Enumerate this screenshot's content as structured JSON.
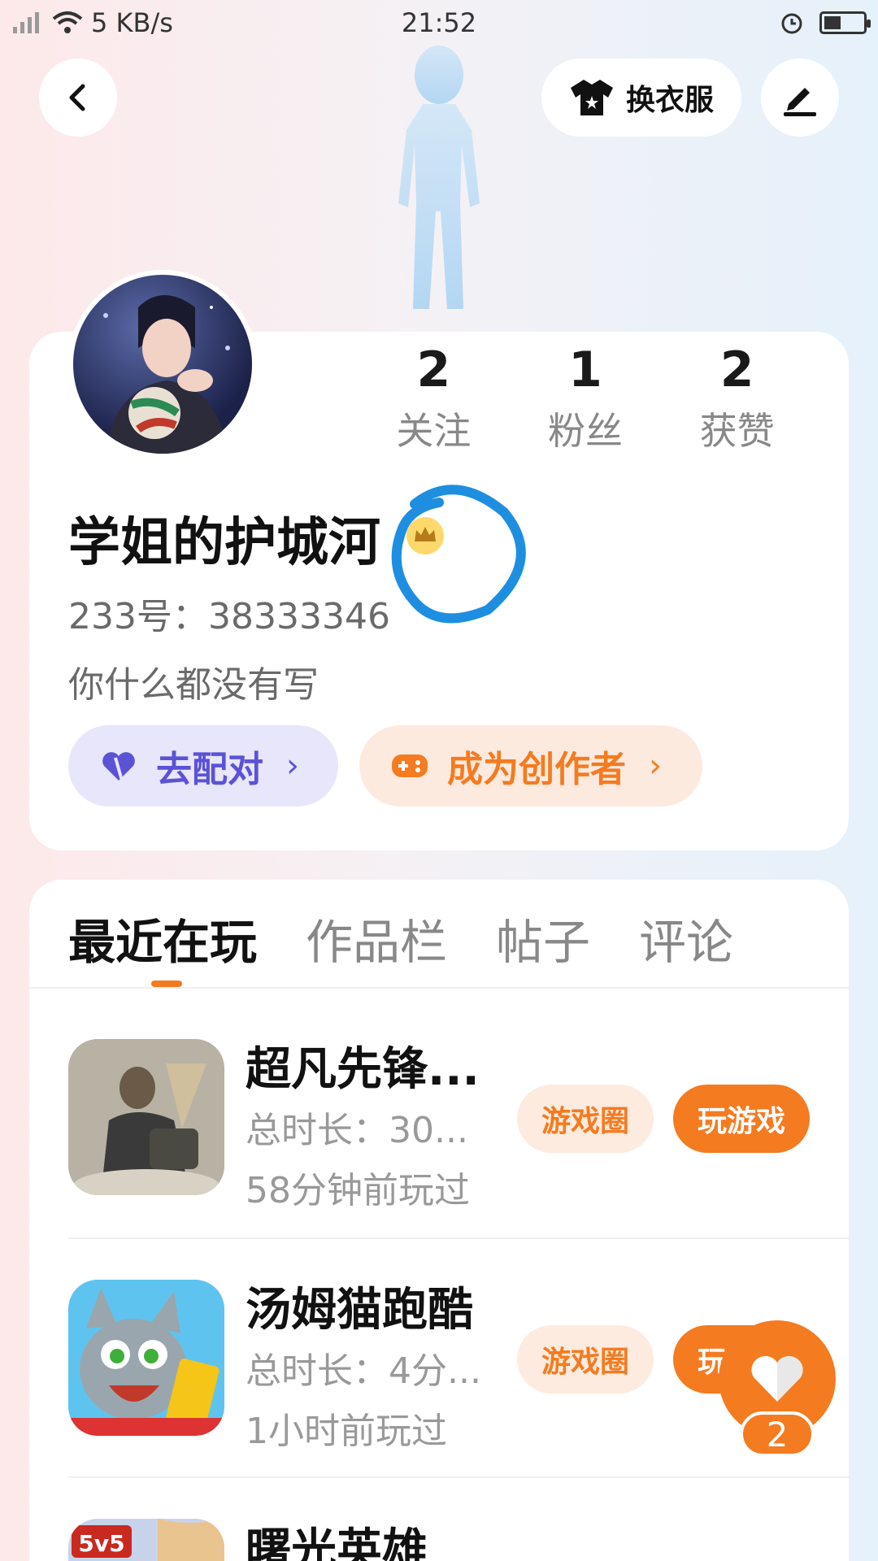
{
  "status_bar": {
    "network_speed": "5 KB/s",
    "time": "21:52"
  },
  "header": {
    "change_outfit_label": "换衣服",
    "icons": {
      "back": "chevron-left-icon",
      "outfit": "tshirt-icon",
      "edit": "pen-icon"
    }
  },
  "profile": {
    "stats": [
      {
        "value": "2",
        "label": "关注"
      },
      {
        "value": "1",
        "label": "粉丝"
      },
      {
        "value": "2",
        "label": "获赞"
      }
    ],
    "username": "学姐的护城河",
    "user_id": "233号：38333346",
    "bio": "你什么都没有写",
    "actions": {
      "match_label": "去配对",
      "creator_label": "成为创作者"
    }
  },
  "tabs": [
    {
      "label": "最近在玩",
      "active": true
    },
    {
      "label": "作品栏",
      "active": false
    },
    {
      "label": "帖子",
      "active": false
    },
    {
      "label": "评论",
      "active": false
    }
  ],
  "games": [
    {
      "title": "超凡先锋...",
      "duration": "总时长：30...",
      "last_played": "58分钟前玩过",
      "circle_label": "游戏圈",
      "play_label": "玩游戏"
    },
    {
      "title": "汤姆猫跑酷",
      "duration": "总时长：4分...",
      "last_played": "1小时前玩过",
      "circle_label": "游戏圈",
      "play_label": "玩游戏"
    },
    {
      "title": "曙光英雄",
      "icon_badge": "5v5"
    }
  ],
  "floating": {
    "like_count": "2"
  },
  "colors": {
    "accent": "#f47b20",
    "match_purple": "#5b52d6",
    "annotation_blue": "#1e8fe0"
  }
}
